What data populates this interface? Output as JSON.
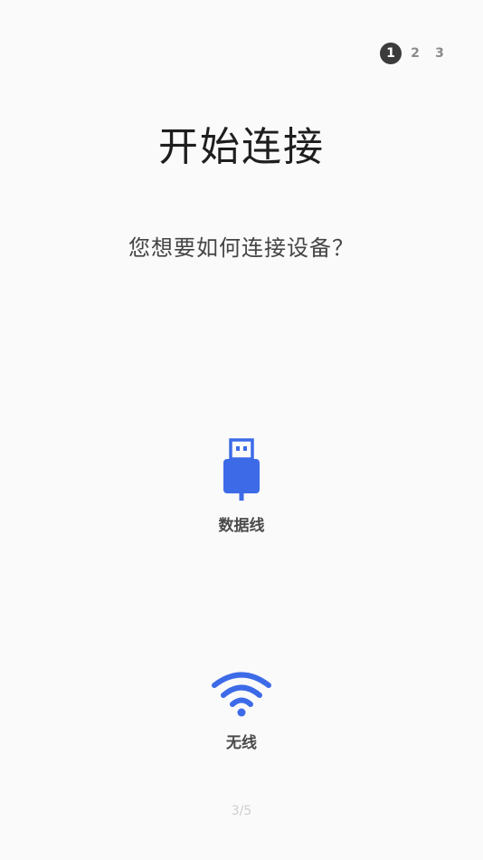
{
  "stepper": {
    "steps": [
      {
        "label": "1",
        "active": true
      },
      {
        "label": "2",
        "active": false
      },
      {
        "label": "3",
        "active": false
      }
    ]
  },
  "title": "开始连接",
  "subtitle": "您想要如何连接设备？",
  "options": {
    "cable": {
      "label": "数据线",
      "icon": "usb-cable-icon"
    },
    "wireless": {
      "label": "无线",
      "icon": "wifi-icon"
    }
  },
  "accent_color": "#3d6be8",
  "page_indicator": "3/5"
}
